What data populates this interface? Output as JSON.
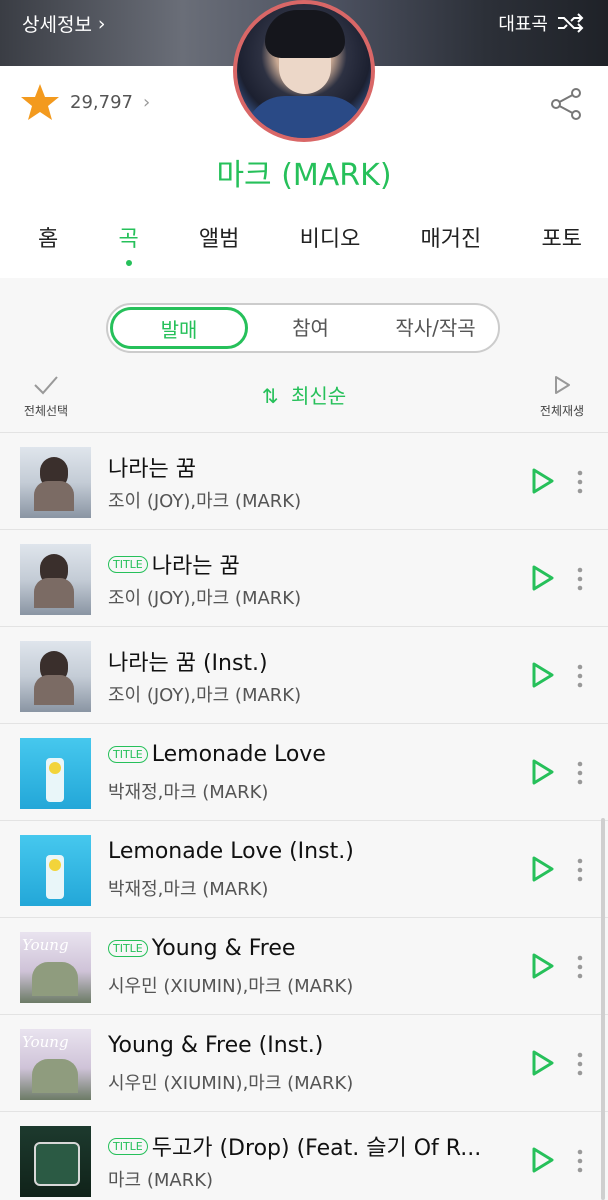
{
  "header": {
    "detail_link": "상세정보",
    "representative": "대표곡",
    "like_count": "29,797",
    "artist_name": "마크 (MARK)"
  },
  "tabs": [
    {
      "label": "홈"
    },
    {
      "label": "곡"
    },
    {
      "label": "앨범"
    },
    {
      "label": "비디오"
    },
    {
      "label": "매거진"
    },
    {
      "label": "포토"
    }
  ],
  "filter": {
    "options": [
      "발매",
      "참여",
      "작사/작곡"
    ]
  },
  "controls": {
    "select_all": "전체선택",
    "sort": "최신순",
    "play_all": "전체재생"
  },
  "badge_text": "TITLE",
  "songs": [
    {
      "title": "나라는 꿈",
      "artist": "조이 (JOY),마크 (MARK)",
      "badge": false
    },
    {
      "title": "나라는 꿈",
      "artist": "조이 (JOY),마크 (MARK)",
      "badge": true
    },
    {
      "title": "나라는 꿈 (Inst.)",
      "artist": "조이 (JOY),마크 (MARK)",
      "badge": false
    },
    {
      "title": "Lemonade Love",
      "artist": "박재정,마크 (MARK)",
      "badge": true
    },
    {
      "title": "Lemonade Love (Inst.)",
      "artist": "박재정,마크 (MARK)",
      "badge": false
    },
    {
      "title": "Young & Free",
      "artist": "시우민 (XIUMIN),마크 (MARK)",
      "badge": true
    },
    {
      "title": "Young & Free (Inst.)",
      "artist": "시우민 (XIUMIN),마크 (MARK)",
      "badge": false
    },
    {
      "title": "두고가 (Drop) (Feat. 슬기 Of R...",
      "artist": "마크 (MARK)",
      "badge": true
    }
  ],
  "colors": {
    "accent": "#26c05a",
    "star": "#f39a1e",
    "avatar_border": "#d96767"
  }
}
